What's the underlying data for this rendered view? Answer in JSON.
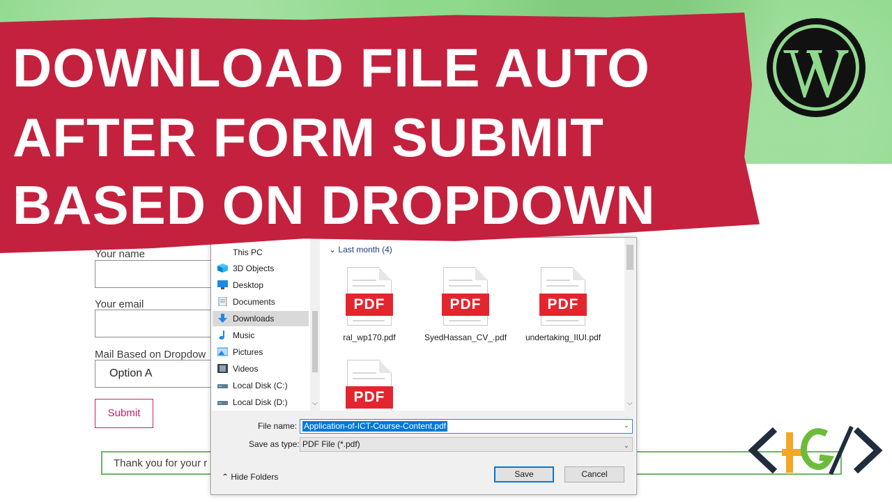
{
  "title": {
    "line1": "DOWNLOAD FILE AUTO",
    "line2": "AFTER FORM SUBMIT",
    "line3": "BASED ON DROPDOWN"
  },
  "form": {
    "name_label": "Your name",
    "email_label": "Your email",
    "dropdown_label": "Mail Based on Dropdow",
    "dropdown_value": "Option A",
    "submit_label": "Submit",
    "thanks_text": "Thank you for your r"
  },
  "dialog": {
    "nav_partial": "This PC",
    "nav_items": [
      {
        "label": "3D Objects",
        "icon": "cube-icon"
      },
      {
        "label": "Desktop",
        "icon": "desktop-icon"
      },
      {
        "label": "Documents",
        "icon": "documents-icon"
      },
      {
        "label": "Downloads",
        "icon": "download-arrow-icon"
      },
      {
        "label": "Music",
        "icon": "music-note-icon"
      },
      {
        "label": "Pictures",
        "icon": "pictures-icon"
      },
      {
        "label": "Videos",
        "icon": "film-icon"
      },
      {
        "label": "Local Disk (C:)",
        "icon": "drive-icon"
      },
      {
        "label": "Local Disk (D:)",
        "icon": "drive-icon"
      }
    ],
    "group_header_partial": "Last month (4)",
    "files": [
      {
        "name": "ral_wp170.pdf",
        "badge": "PDF"
      },
      {
        "name": "SyedHassan_CV_.pdf",
        "badge": "PDF"
      },
      {
        "name": "undertaking_IIUI.pdf",
        "badge": "PDF"
      },
      {
        "name": "",
        "badge": "PDF"
      }
    ],
    "file_name_label": "File name:",
    "file_name_value": "Application-of-ICT-Course-Content.pdf",
    "save_type_label": "Save as type:",
    "save_type_value": "PDF File (*.pdf)",
    "hide_folders": "Hide Folders",
    "save_button": "Save",
    "cancel_button": "Cancel"
  },
  "colors": {
    "banner": "#c4213f",
    "background_green": "#8fd98c",
    "pdf_red": "#e3262e",
    "selection_blue": "#0078d7",
    "submit_accent": "#c4216a"
  }
}
